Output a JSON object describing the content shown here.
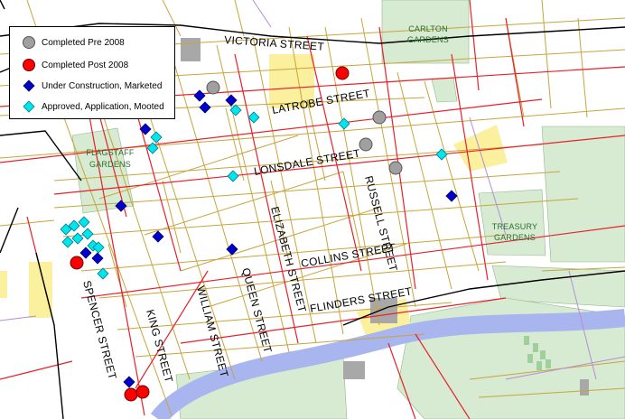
{
  "legend": {
    "items": [
      {
        "label": "Completed Pre 2008",
        "symbol": "circle",
        "color": "#a0a0a0"
      },
      {
        "label": "Completed Post 2008",
        "symbol": "circle",
        "color": "#ff0000"
      },
      {
        "label": "Under Construction, Marketed",
        "symbol": "diamond",
        "color": "#0000cc"
      },
      {
        "label": "Approved, Application, Mooted",
        "symbol": "diamond",
        "color": "#00e5ee"
      }
    ]
  },
  "streets": {
    "victoria": "VICTORIA STREET",
    "latrobe": "LATROBE STREET",
    "lonsdale": "LONSDALE STREET",
    "collins": "COLLINS STREET",
    "flinders": "FLINDERS STREET",
    "russell": "RUSSELL STREET",
    "elizabeth": "ELIZABETH STREET",
    "queen": "QUEEN STREET",
    "william": "WILLIAM STREET",
    "king": "KING STREET",
    "spencer": "SPENCER STREET"
  },
  "parks": {
    "carlton": [
      "CARLTON",
      "GARDENS"
    ],
    "flagstaff": [
      "FLAGSTAFF",
      "GARDENS"
    ],
    "treasury": [
      "TREASURY",
      "GARDENS"
    ]
  },
  "colors": {
    "park": "#d6ebd1",
    "minor_road": "#c8a43c",
    "major_road": "#e8202a",
    "rail": "#000000",
    "river": "#a8b5ee",
    "yellow_area": "#faf09e",
    "boundary": "#b48cd6",
    "pre_2008": "#a0a0a0",
    "post_2008": "#ff0000",
    "under_construction": "#0000cc",
    "approved": "#00e5ee"
  }
}
